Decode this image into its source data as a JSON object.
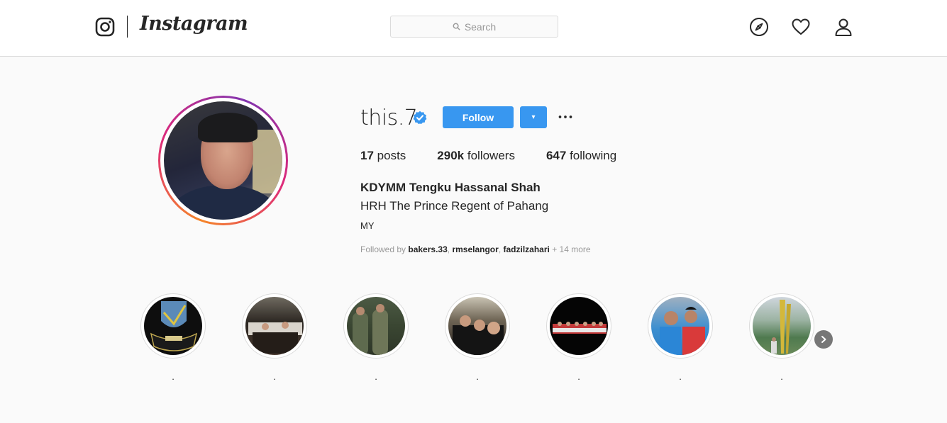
{
  "nav": {
    "brand": "Instagram",
    "search_placeholder": "Search",
    "icons": [
      "instagram-glyph-icon",
      "search-icon",
      "explore-compass-icon",
      "heart-icon",
      "profile-icon"
    ]
  },
  "profile": {
    "username": "this.7",
    "verified": true,
    "follow_label": "Follow",
    "dropdown_label": "▾",
    "more_label": "•••",
    "stats": {
      "posts_count": "17",
      "posts_label": "posts",
      "followers_count": "290k",
      "followers_label": "followers",
      "following_count": "647",
      "following_label": "following"
    },
    "full_name": "KDYMM Tengku Hassanal Shah",
    "bio": "HRH The Prince Regent of Pahang",
    "country": "MY",
    "followed_by": {
      "prefix": "Followed by",
      "accounts": [
        "bakers.33",
        "rmselangor",
        "fadzilzahari"
      ],
      "sep": ",",
      "more": "+ 14 more"
    }
  },
  "highlights": [
    {
      "label": "."
    },
    {
      "label": "."
    },
    {
      "label": "."
    },
    {
      "label": "."
    },
    {
      "label": "."
    },
    {
      "label": "."
    },
    {
      "label": "."
    }
  ],
  "colors": {
    "accent_blue": "#3897f0",
    "text": "#262626",
    "muted": "#999999",
    "border": "#dbdbdb",
    "background": "#fafafa"
  }
}
